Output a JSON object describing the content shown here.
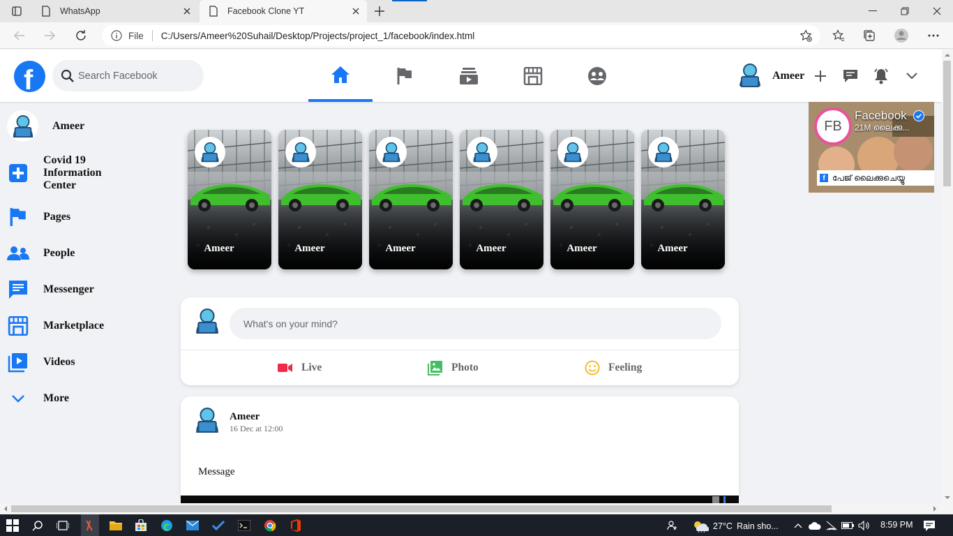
{
  "browser": {
    "tabs": [
      {
        "title": "WhatsApp",
        "active": false
      },
      {
        "title": "Facebook Clone YT",
        "active": true
      }
    ],
    "url_scheme_label": "File",
    "url": "C:/Users/Ameer%20Suhail/Desktop/Projects/project_1/facebook/index.html"
  },
  "header": {
    "logo_letter": "f",
    "search_placeholder": "Search Facebook",
    "user_name": "Ameer",
    "nav_icons": [
      "home-icon",
      "flag-icon",
      "watch-icon",
      "marketplace-icon",
      "groups-icon"
    ],
    "right_icons": [
      "plus-icon",
      "messenger-icon",
      "bell-icon",
      "chevron-down-icon"
    ]
  },
  "sidebar": {
    "user_name": "Ameer",
    "items": [
      {
        "label": "Covid 19 Information Center",
        "icon": "plus-square-icon"
      },
      {
        "label": "Pages",
        "icon": "flag-icon"
      },
      {
        "label": "People",
        "icon": "people-icon"
      },
      {
        "label": "Messenger",
        "icon": "chat-icon"
      },
      {
        "label": "Marketplace",
        "icon": "store-icon"
      },
      {
        "label": "Videos",
        "icon": "video-icon"
      },
      {
        "label": "More",
        "icon": "chevron-down-icon"
      }
    ]
  },
  "stories": [
    {
      "name": "Ameer"
    },
    {
      "name": "Ameer"
    },
    {
      "name": "Ameer"
    },
    {
      "name": "Ameer"
    },
    {
      "name": "Ameer"
    },
    {
      "name": "Ameer"
    }
  ],
  "composer": {
    "placeholder": "What's on your mind?",
    "actions": [
      {
        "label": "Live",
        "icon": "live-video-icon",
        "color": "#f02849"
      },
      {
        "label": "Photo",
        "icon": "photo-icon",
        "color": "#45bd62"
      },
      {
        "label": "Feeling",
        "icon": "smile-icon",
        "color": "#f7b928"
      }
    ]
  },
  "post": {
    "author": "Ameer",
    "date": "16 Dec at 12:00",
    "message": "Message"
  },
  "ad": {
    "logo_text": "FB",
    "title": "Facebook",
    "subtitle": "21M ലൈക്കു...",
    "cta": "പേജ് ലൈക്കുചെയ്യൂ"
  },
  "taskbar": {
    "temperature": "27°C",
    "weather": "Rain sho...",
    "time": "8:59 PM"
  },
  "colors": {
    "brand": "#1877f2",
    "background": "#f0f2f5"
  }
}
